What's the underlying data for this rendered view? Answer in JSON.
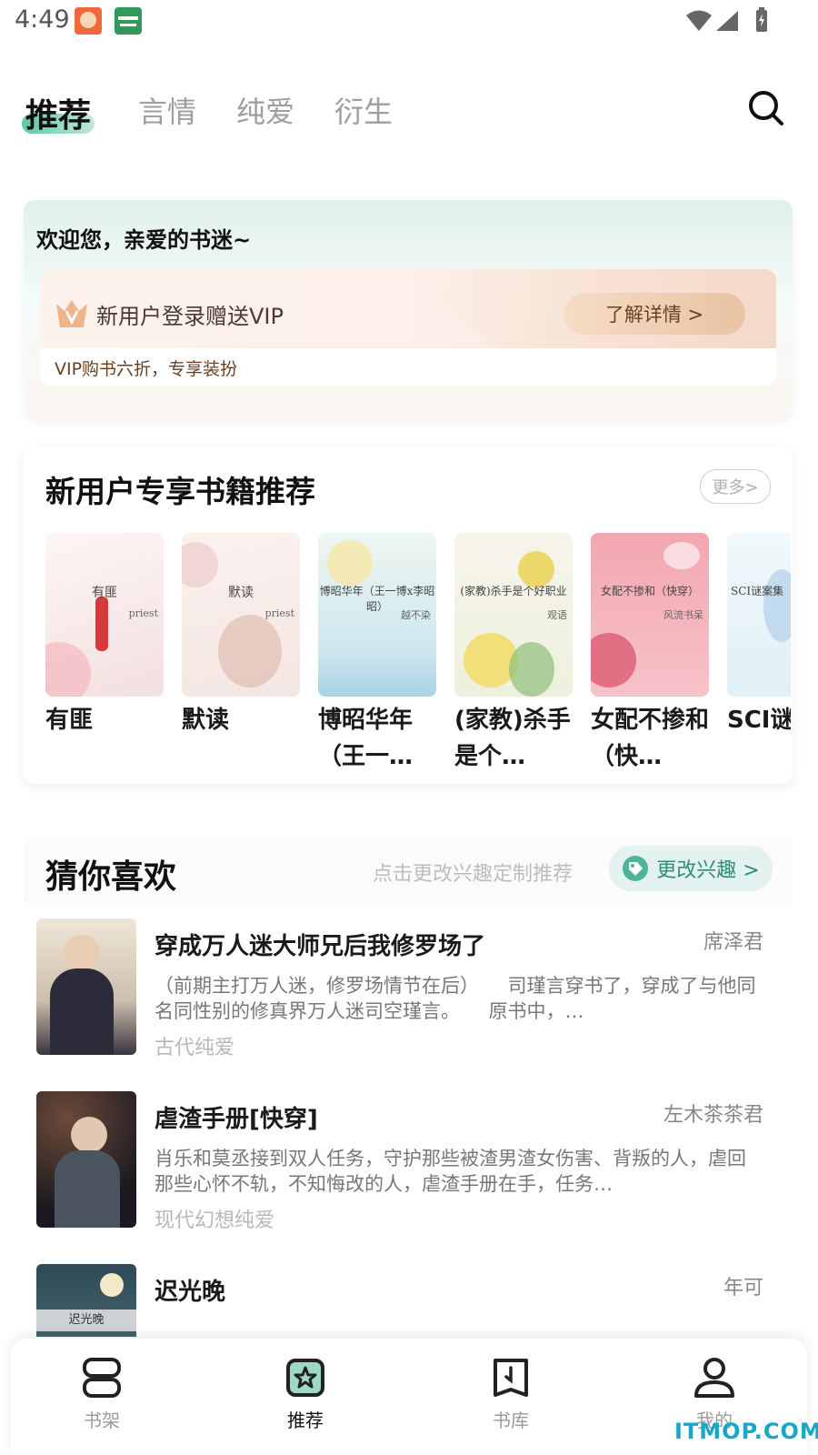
{
  "status_bar": {
    "time": "4:49"
  },
  "tabs": [
    {
      "label": "推荐",
      "active": true
    },
    {
      "label": "言情"
    },
    {
      "label": "纯爱"
    },
    {
      "label": "衍生"
    }
  ],
  "welcome": {
    "title": "欢迎您，亲爱的书迷~",
    "vip_title": "新用户登录赠送VIP",
    "details_button": "了解详情 >",
    "vip_subtitle": "VIP购书六折，专享装扮"
  },
  "new_user_books": {
    "title": "新用户专享书籍推荐",
    "more": "更多>",
    "books": [
      {
        "name": "有匪",
        "cover_title": "有匪",
        "cover_author": "priest"
      },
      {
        "name": "默读",
        "cover_title": "默读",
        "cover_author": "priest"
      },
      {
        "name": "博昭华年（王一…",
        "cover_title": "博昭华年（王一博x李昭昭）",
        "cover_author": "越不染"
      },
      {
        "name": "(家教)杀手是个…",
        "cover_title": "(家教)杀手是个好职业",
        "cover_author": "观语"
      },
      {
        "name": "女配不掺和（快…",
        "cover_title": "女配不掺和（快穿）",
        "cover_author": "风流书呆"
      },
      {
        "name": "SCI谜集（第",
        "cover_title": "SCI谜案集（",
        "cover_author": ""
      }
    ]
  },
  "guess": {
    "title": "猜你喜欢",
    "hint": "点击更改兴趣定制推荐",
    "change_button": "更改兴趣 >",
    "items": [
      {
        "title": "穿成万人迷大师兄后我修罗场了",
        "author": "席泽君",
        "description": "（前期主打万人迷，修罗场情节在后）　　司瑾言穿书了，穿成了与他同名同性别的修真界万人迷司空瑾言。　　原书中，…",
        "genre": "古代纯爱"
      },
      {
        "title": "虐渣手册[快穿]",
        "author": "左木茶茶君",
        "description": "肖乐和莫丞接到双人任务，守护那些被渣男渣女伤害、背叛的人，虐回那些心怀不轨，不知悔改的人，虐渣手册在手，任务…",
        "genre": "现代幻想纯爱"
      },
      {
        "title": "迟光晚",
        "author": "年可",
        "cover_title": "迟光晚",
        "description": "",
        "genre": ""
      }
    ]
  },
  "bottom_nav": [
    {
      "label": "书架",
      "icon": "bookshelf-icon"
    },
    {
      "label": "推荐",
      "icon": "recommend-icon",
      "active": true
    },
    {
      "label": "书库",
      "icon": "library-icon"
    },
    {
      "label": "我的",
      "icon": "profile-icon"
    }
  ],
  "watermark": "ITMOP.COM",
  "colors": {
    "accent": "#2f8d78",
    "tab_underline": "#62c5a6",
    "vip_brown": "#6b3f20"
  }
}
